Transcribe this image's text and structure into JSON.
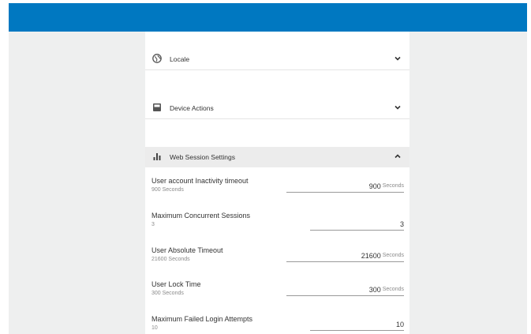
{
  "sections": {
    "locale": {
      "label": "Locale",
      "icon": "globe-icon",
      "chevron": "chevron-down-icon"
    },
    "device_actions": {
      "label": "Device Actions",
      "icon": "device-icon",
      "chevron": "chevron-down-icon"
    },
    "web_session": {
      "label": "Web Session Settings",
      "icon": "bar-chart-icon",
      "chevron": "chevron-up-icon"
    }
  },
  "settings": [
    {
      "label": "User account Inactivity timeout",
      "hint": "900 Seconds",
      "value": "900",
      "unit": "Seconds"
    },
    {
      "label": "Maximum Concurrent Sessions",
      "hint": "3",
      "value": "3",
      "unit": ""
    },
    {
      "label": "User Absolute Timeout",
      "hint": "21600 Seconds",
      "value": "21600",
      "unit": "Seconds"
    },
    {
      "label": "User Lock Time",
      "hint": "300 Seconds",
      "value": "300",
      "unit": "Seconds"
    },
    {
      "label": "Maximum Failed Login Attempts",
      "hint": "10",
      "value": "10",
      "unit": ""
    }
  ],
  "colors": {
    "header": "#0078c1",
    "background": "#eeefef",
    "active_section": "#ececec"
  }
}
